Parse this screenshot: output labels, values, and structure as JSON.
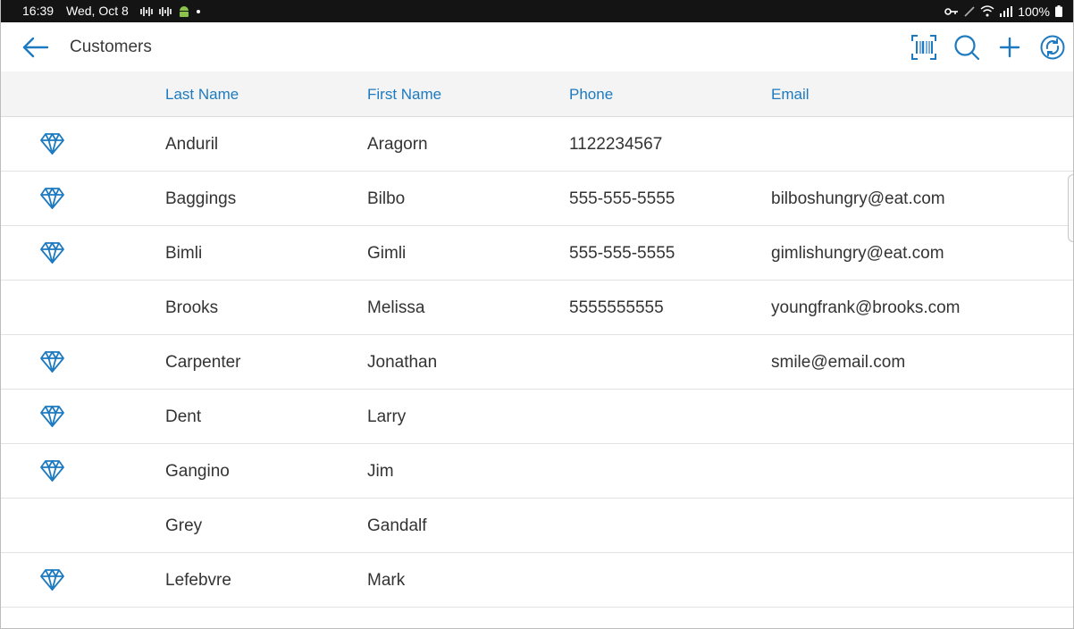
{
  "status_bar": {
    "time": "16:39",
    "date": "Wed, Oct 8",
    "battery": "100%"
  },
  "app_bar": {
    "title": "Customers",
    "icons": [
      "back-arrow-icon",
      "barcode-scan-icon",
      "search-icon",
      "add-icon",
      "sync-icon"
    ]
  },
  "colors": {
    "accent": "#1d7ac0",
    "header_bg": "#f4f4f4",
    "status_bar_bg": "#141414"
  },
  "table": {
    "columns": [
      "",
      "Last Name",
      "First Name",
      "Phone",
      "Email"
    ],
    "rows": [
      {
        "vip": true,
        "last": "Anduril",
        "first": "Aragorn",
        "phone": "1122234567",
        "email": ""
      },
      {
        "vip": true,
        "last": "Baggings",
        "first": "Bilbo",
        "phone": "555-555-5555",
        "email": "bilboshungry@eat.com"
      },
      {
        "vip": true,
        "last": "Bimli",
        "first": "Gimli",
        "phone": "555-555-5555",
        "email": "gimlishungry@eat.com"
      },
      {
        "vip": false,
        "last": "Brooks",
        "first": "Melissa",
        "phone": "5555555555",
        "email": "youngfrank@brooks.com"
      },
      {
        "vip": true,
        "last": "Carpenter",
        "first": "Jonathan",
        "phone": "",
        "email": "smile@email.com"
      },
      {
        "vip": true,
        "last": "Dent",
        "first": "Larry",
        "phone": "",
        "email": ""
      },
      {
        "vip": true,
        "last": "Gangino",
        "first": "Jim",
        "phone": "",
        "email": ""
      },
      {
        "vip": false,
        "last": "Grey",
        "first": "Gandalf",
        "phone": "",
        "email": ""
      },
      {
        "vip": true,
        "last": "Lefebvre",
        "first": "Mark",
        "phone": "",
        "email": ""
      }
    ]
  }
}
